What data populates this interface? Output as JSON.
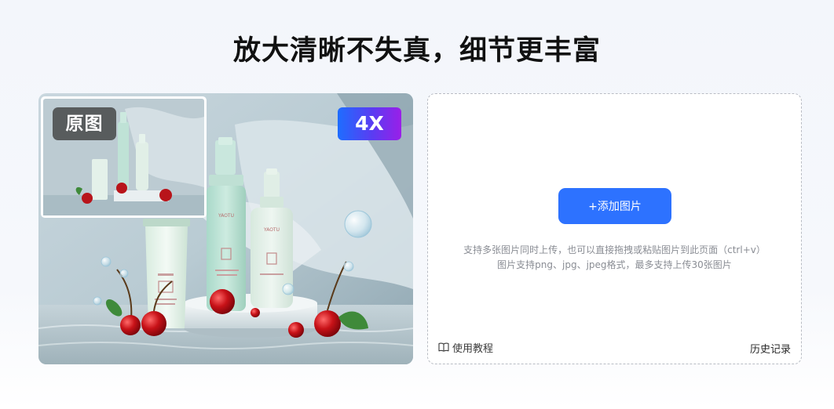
{
  "header": {
    "title": "放大清晰不失真，细节更丰富"
  },
  "demo": {
    "original_badge": "原图",
    "scale_badge": "4X",
    "bottle_label": "YAOTU",
    "icons": [
      "product-bottle",
      "cherry",
      "water-bubble"
    ]
  },
  "upload": {
    "button_label": "+添加图片",
    "hint_line1": "支持多张图片同时上传，也可以直接拖拽或粘贴图片到此页面（ctrl+v）",
    "hint_line2": "图片支持png、jpg、jpeg格式，最多支持上传30张图片",
    "tutorial_label": "使用教程",
    "tutorial_icon": "book-icon",
    "history_label": "历史记录"
  },
  "colors": {
    "accent": "#2d72ff",
    "scale_badge_gradient": [
      "#1e6dff",
      "#9a1fe8"
    ]
  }
}
